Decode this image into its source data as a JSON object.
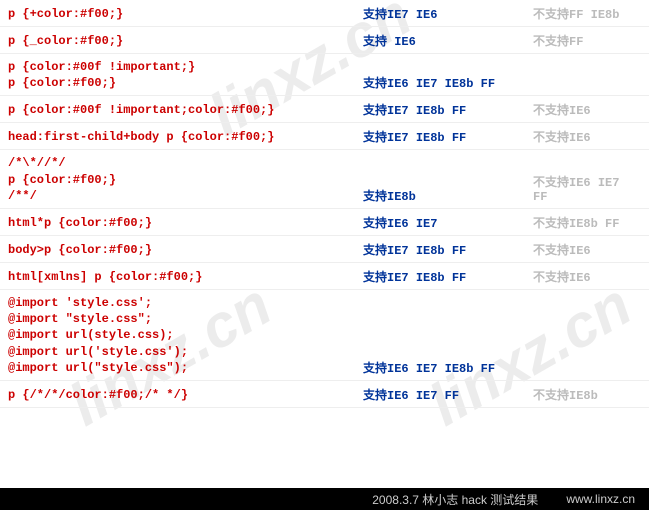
{
  "watermark": "linxz.cn",
  "labels": {
    "support": "支持",
    "not_support": "不支持"
  },
  "rows": [
    {
      "code": "p {+color:#f00;}",
      "yes": "IE7 IE6",
      "no": "FF IE8b"
    },
    {
      "code": "p {_color:#f00;}",
      "yes": " IE6",
      "no": "FF"
    },
    {
      "code": "p {color:#00f !important;}\np {color:#f00;}",
      "yes": "IE6 IE7 IE8b FF",
      "no": ""
    },
    {
      "code": "p {color:#00f !important;color:#f00;}",
      "yes": "IE7 IE8b FF",
      "no": "IE6"
    },
    {
      "code": "head:first-child+body p {color:#f00;}",
      "yes": "IE7 IE8b FF",
      "no": "IE6"
    },
    {
      "code": "/*\\*//*/\np {color:#f00;}\n/**/",
      "yes": "IE8b",
      "no": "IE6 IE7 FF"
    },
    {
      "code": "html*p {color:#f00;}",
      "yes": "IE6 IE7",
      "no": "IE8b FF"
    },
    {
      "code": "body>p {color:#f00;}",
      "yes": "IE7 IE8b FF",
      "no": "IE6"
    },
    {
      "code": "html[xmlns] p {color:#f00;}",
      "yes": "IE7 IE8b FF",
      "no": "IE6"
    },
    {
      "code": "@import 'style.css';\n@import \"style.css\";\n@import url(style.css);\n@import url('style.css');\n@import url(\"style.css\");",
      "yes": "IE6 IE7 IE8b FF",
      "no": ""
    },
    {
      "code": "p {/*/*/color:#f00;/* */}",
      "yes": "IE6 IE7 FF",
      "no": "IE8b"
    }
  ],
  "footer": {
    "text": "2008.3.7 林小志 hack 测试结果",
    "url": "www.linxz.cn"
  }
}
